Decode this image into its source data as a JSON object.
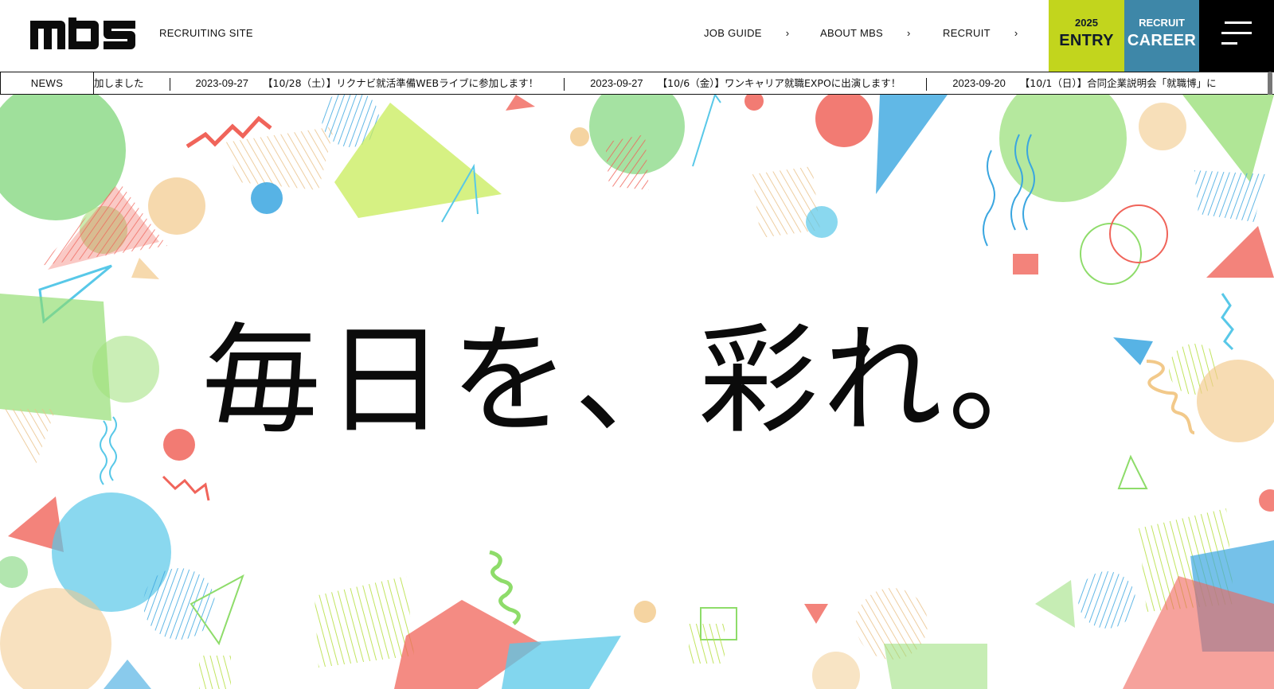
{
  "header": {
    "logo_text": "MBS",
    "site_label": "RECRUITING SITE",
    "nav": [
      {
        "label": "JOB GUIDE",
        "chevron": "›"
      },
      {
        "label": "ABOUT MBS",
        "chevron": "›"
      },
      {
        "label": "RECRUIT",
        "chevron": "›"
      }
    ],
    "entry": {
      "small": "2025",
      "big": "ENTRY",
      "color": "#c2d51d"
    },
    "career": {
      "small": "RECRUIT",
      "big": "CAREER",
      "color": "#3e87a8"
    },
    "menu_icon": "hamburger-menu-icon"
  },
  "news": {
    "label": "NEWS",
    "items": [
      {
        "date": "",
        "title": "加しました"
      },
      {
        "date": "2023-09-27",
        "title": "【10/28（土）】リクナビ就活準備WEBライブに参加します！"
      },
      {
        "date": "2023-09-27",
        "title": "【10/6（金）】ワンキャリア就職EXPOに出演します！"
      },
      {
        "date": "2023-09-20",
        "title": "【10/1（日）】合同企業説明会「就職博」に"
      }
    ]
  },
  "hero": {
    "copy": "毎日を、彩れ。",
    "palette": [
      "#f0645a",
      "#58c8e8",
      "#8edc6a",
      "#c8ec5a",
      "#f2c98a"
    ]
  }
}
